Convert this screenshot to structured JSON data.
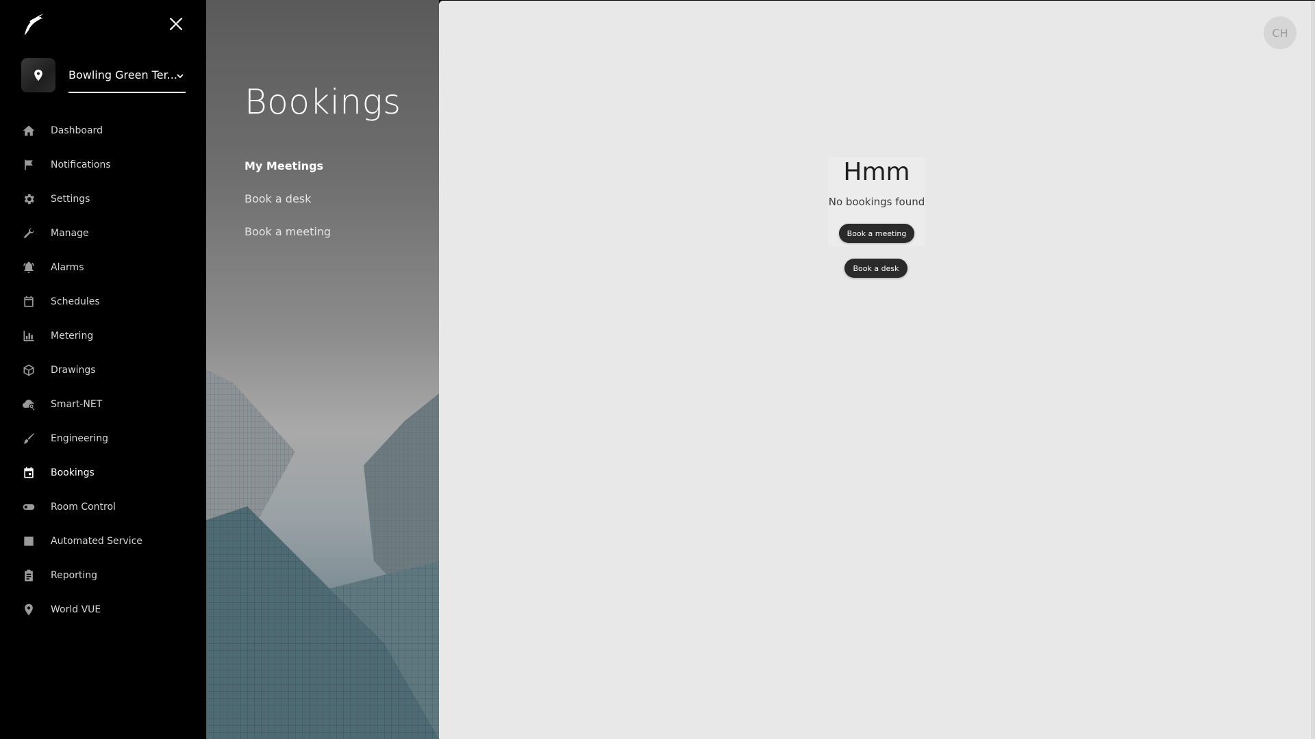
{
  "sidebar": {
    "site": {
      "name": "Bowling Green Ter..."
    },
    "items": [
      {
        "label": "Dashboard",
        "icon": "home-icon"
      },
      {
        "label": "Notifications",
        "icon": "flag-icon"
      },
      {
        "label": "Settings",
        "icon": "gear-icon"
      },
      {
        "label": "Manage",
        "icon": "wrench-icon"
      },
      {
        "label": "Alarms",
        "icon": "bell-icon"
      },
      {
        "label": "Schedules",
        "icon": "calendar-icon"
      },
      {
        "label": "Metering",
        "icon": "bar-chart-icon"
      },
      {
        "label": "Drawings",
        "icon": "cube-icon"
      },
      {
        "label": "Smart-NET",
        "icon": "cloud-search-icon"
      },
      {
        "label": "Engineering",
        "icon": "brush-icon"
      },
      {
        "label": "Bookings",
        "icon": "calendar-event-icon",
        "active": true
      },
      {
        "label": "Room Control",
        "icon": "toggle-icon"
      },
      {
        "label": "Automated Service",
        "icon": "service-icon"
      },
      {
        "label": "Reporting",
        "icon": "clipboard-icon"
      },
      {
        "label": "World VUE",
        "icon": "location-pin-icon"
      }
    ]
  },
  "hero": {
    "title": "Bookings",
    "subnav": [
      {
        "label": "My Meetings",
        "active": true
      },
      {
        "label": "Book a desk"
      },
      {
        "label": "Book a meeting"
      }
    ]
  },
  "main": {
    "avatar_initials": "CH",
    "empty_state": {
      "title": "Hmm",
      "message": "No bookings found",
      "book_meeting_label": "Book a meeting",
      "book_desk_label": "Book a desk"
    }
  }
}
